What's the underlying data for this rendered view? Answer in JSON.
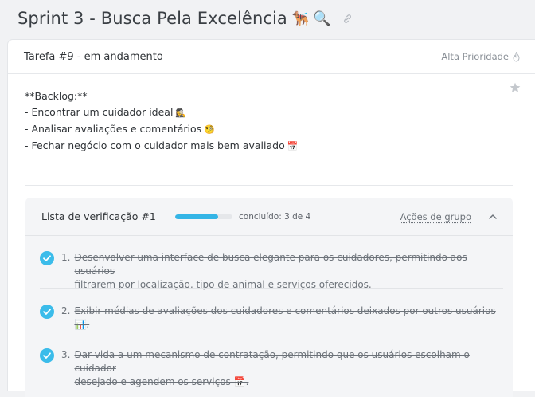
{
  "page": {
    "title": "Sprint 3 - Busca Pela Excelência",
    "title_emojis": [
      "🐕‍🦺",
      "🔍"
    ]
  },
  "task": {
    "title": "Tarefa #9 - em andamento",
    "priority_label": "Alta Prioridade"
  },
  "description": {
    "lines": [
      "**Backlog:**",
      "- Encontrar um cuidador ideal",
      "- Analisar avaliações e comentários",
      "- Fechar negócio com o cuidador mais bem avaliado"
    ],
    "line_emojis": [
      "",
      "🕵️‍♀️",
      "🧐",
      "📅"
    ]
  },
  "checklist": {
    "title": "Lista de verificação #1",
    "progress_label": "concluído: 3 de 4",
    "progress_fraction": 0.75,
    "group_actions_label": "Ações de grupo",
    "items": [
      {
        "num": "1.",
        "line1": "Desenvolver uma interface de busca elegante para os cuidadores, permitindo aos usuários",
        "line2": "filtrarem por localização, tipo de animal e serviços oferecidos."
      },
      {
        "num": "2.",
        "line1": "Exibir médias de avaliações dos cuidadores e comentários deixados por outros usuários 📊.",
        "line2": ""
      },
      {
        "num": "3.",
        "line1": "Dar vida a um mecanismo de contratação, permitindo que os usuários escolham o cuidador",
        "line2": "desejado e agendem os serviços 📅."
      }
    ]
  },
  "colors": {
    "accent": "#34b5e6",
    "check": "#3bbcea",
    "background": "#f1f2f4"
  }
}
